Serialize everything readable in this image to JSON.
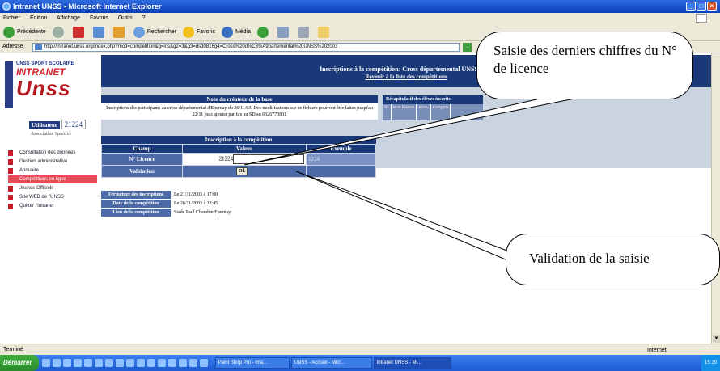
{
  "window": {
    "title": "Intranet UNSS - Microsoft Internet Explorer"
  },
  "menu": [
    "Fichier",
    "Edition",
    "Affichage",
    "Favoris",
    "Outils",
    "?"
  ],
  "toolbar": {
    "back": "Précédente",
    "search": "Rechercher",
    "favorites": "Favoris",
    "media": "Média"
  },
  "address": {
    "label": "Adresse",
    "url": "http://intranet.unss.org/index.php?mod=competition&g=ins&g2=3&g3=dsd0816g4=Cross%20d%C3%A9partemental%20UNSS%202003",
    "go": "OK"
  },
  "sidebar": {
    "logo_top": "UNSS SPORT SCOLAIRE",
    "logo_mid": "INTRANET",
    "logo_main": "Unss",
    "user_label": "Utilisateur",
    "user_value": "21224",
    "association": "Association Sportive",
    "items": [
      "Consultation des données",
      "Gestion administrative",
      "Annuaire",
      "Compétitions en ligne",
      "Jeunes Officiels",
      "Site WEB de l'UNSS",
      "Quitter l'Intranet"
    ]
  },
  "banner": {
    "title": "Inscriptions à la compétition: Cross départemental UNSS 2003",
    "link": "Revenir à la liste des compétitions"
  },
  "note": {
    "title": "Note du créateur de la base",
    "body": "Inscriptions des participants au cross départemental d'Epernay du 26/11/03. Des modifications sur ce fichiers pourront être faites jusqu'au 22/11 puis ajouter par fax au SD au 0326773831"
  },
  "recap": {
    "title": "Récapitulatif des élèves inscrits",
    "cols": [
      "N°",
      "Nom Prénom",
      "Naiss.",
      "Catégorie"
    ]
  },
  "form": {
    "title": "Inscription à la compétition",
    "col_field": "Champ",
    "col_value": "Valeur",
    "col_example": "Exemple",
    "licence_label": "N° Licence",
    "licence_value": "21224",
    "licence_example": "1234",
    "validation_label": "Validation",
    "ok_label": "Ok"
  },
  "dates": [
    {
      "k": "Fermeture des inscriptions",
      "v": "Le 21/11/2003 à 17:00"
    },
    {
      "k": "Date de la compétition",
      "v": "Le 26/11/2003 à 12:45"
    },
    {
      "k": "Lieu de la compétition",
      "v": "Stade Paul Chandon Epernay"
    }
  ],
  "status": {
    "left": "Terminé",
    "zone": "Internet"
  },
  "taskbar": {
    "start": "Démarrer",
    "tasks": [
      "Paint Shop Pro - Ima...",
      "UNSS - Accueil - Micr...",
      "Intranet UNSS - Mi..."
    ],
    "clock": "15:19"
  },
  "callouts": {
    "licence": "Saisie des derniers chiffres du N° de licence",
    "validation": "Validation de la saisie"
  }
}
